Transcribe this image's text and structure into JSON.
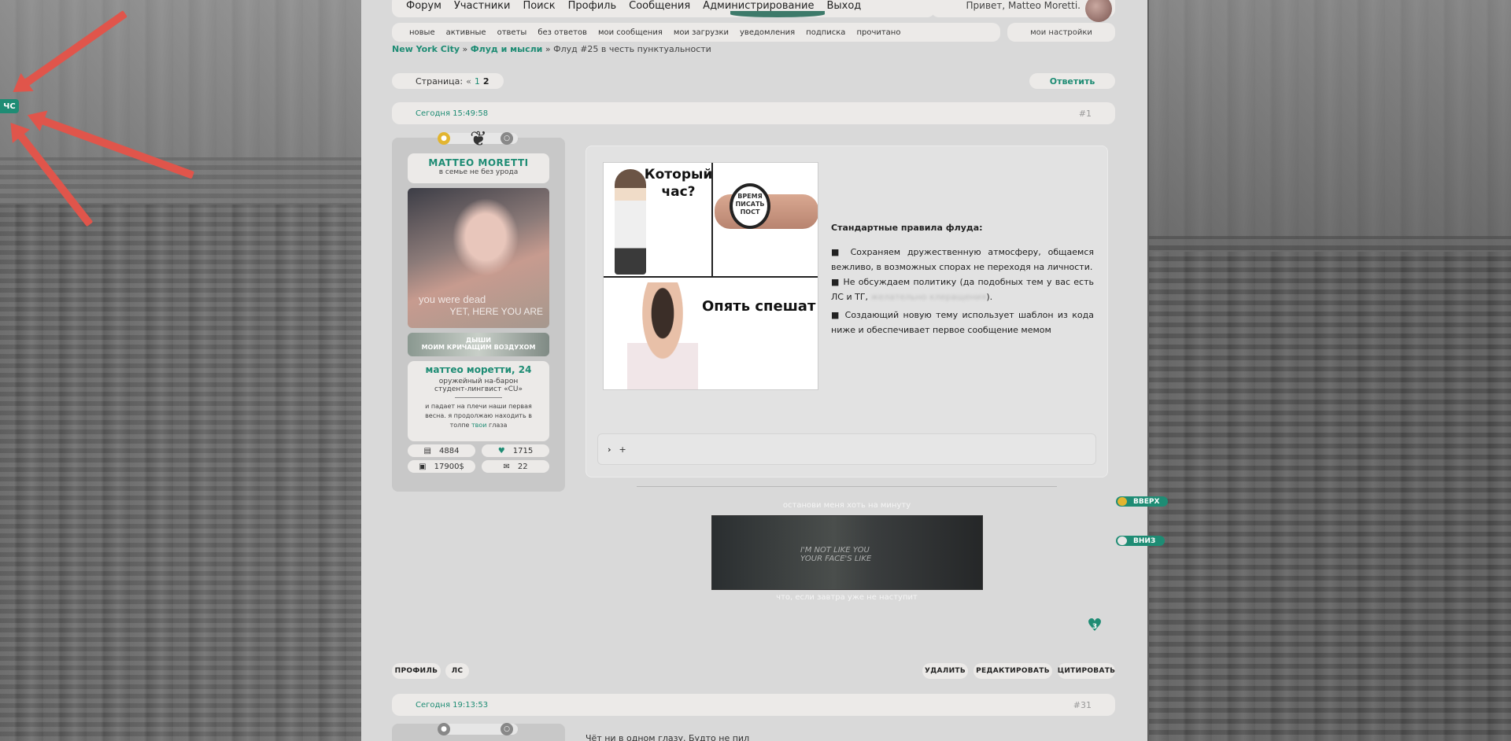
{
  "topnav": [
    "Форум",
    "Участники",
    "Поиск",
    "Профиль",
    "Сообщения",
    "Администрирование",
    "Выход"
  ],
  "greeting": "Привет, Matteo Moretti.",
  "subnav": [
    "новые",
    "активные",
    "ответы",
    "без ответов",
    "мои сообщения",
    "мои загрузки",
    "уведомления",
    "подписка",
    "прочитано"
  ],
  "my_settings": "мои настройки",
  "breadcrumb": {
    "crumb1": "New York City",
    "sep1": " » ",
    "crumb2": "Флуд и мысли",
    "sep2": " » ",
    "current": "Флуд #25 в честь пунктуальности"
  },
  "pager": {
    "label": "Страница:",
    "prev": "«",
    "pages": [
      "1",
      "2"
    ]
  },
  "reply": "Ответить",
  "side_tag": "ЧС",
  "post1": {
    "time": "Сегодня 15:49:58",
    "num": "#1",
    "author": "MATTEO MORETTI",
    "author_sub": "в семье не без урода",
    "avatar_text1": "you were dead",
    "avatar_text2": "YET, HERE YOU ARE",
    "banner_line1": "ДЫШИ",
    "banner_line2": "МОИМ КРИЧАЩИМ ВОЗДУХОМ",
    "char_name": "маттео моретти, 24",
    "char_line1": "оружейный на-барон",
    "char_line2": "студент-лингвист «CU»",
    "quote_a": "и падает на плечи наши первая весна. я продолжаю находить в толпе ",
    "quote_link": "твои",
    "quote_b": " глаза",
    "stats": {
      "posts": "4884",
      "likes": "1715",
      "money": "17900$",
      "pm": "22"
    },
    "meme_q": "Который час?",
    "meme_watch": "ВРЕМЯ ПИСАТЬ ПОСТ",
    "meme_a": "Опять спешат",
    "rules_title": "Стандартные правила флуда:",
    "rule1": "■  Сохраняем дружественную атмосферу, общаемся вежливо, в возможных спорах не переходя на личности.",
    "rule2a": "■ Не обсуждаем политику (да подобных тем у вас есть ЛС и ТГ, ",
    "rule2_blur": "желательно клеращения",
    "rule2b": ").",
    "rule3": "■  Создающий новую тему использует шаблон из кода ниже и обеспечивает первое сообщение мемом",
    "spoiler_plus": "+",
    "sig_top": "останови меня хоть на минуту",
    "sig_img_line1": "I'M NOT LIKE YOU",
    "sig_img_line2": "YOUR FACE'S LIKE",
    "sig_bottom": "что, если завтра уже не наступит",
    "like_count": "3"
  },
  "actions": {
    "profile": "ПРОФИЛЬ",
    "pm": "ЛС",
    "delete": "УДАЛИТЬ",
    "edit": "РЕДАКТИРОВАТЬ",
    "quote": "ЦИТИРОВАТЬ"
  },
  "scroll": {
    "up": "ВВЕРХ",
    "down": "ВНИЗ"
  },
  "post2": {
    "time": "Сегодня 19:13:53",
    "num": "#31",
    "text": "Чёт ни в одном глазу. Будто не пил"
  },
  "colors": {
    "accent": "#1e8c74",
    "arrow": "#e0554b",
    "panel": "#d9d9d9"
  }
}
